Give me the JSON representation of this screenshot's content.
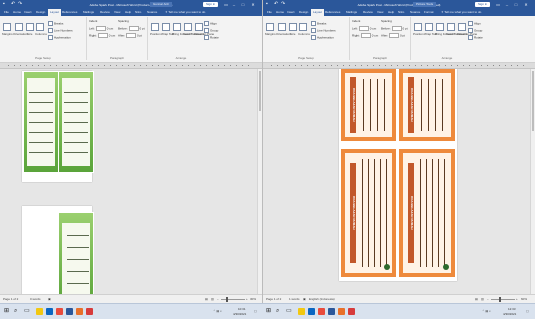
{
  "left_window": {
    "title": "Adobe Spark Post - Microsoft Word (Product Activation Failed)",
    "title_extra": "Gunnar Anh",
    "sign_in": "Sign in",
    "quick_access": [
      "save-icon",
      "undo-icon",
      "redo-icon"
    ],
    "tabs": [
      "File",
      "Home",
      "Insert",
      "Design",
      "Layout",
      "References",
      "Mailings",
      "Review",
      "View",
      "Help",
      "Nitro",
      "Nuance"
    ],
    "active_tab": "Layout",
    "tell_me": "Tell me what you want to do",
    "ribbon": {
      "big_buttons": [
        "Margins",
        "Orientation",
        "Size",
        "Columns"
      ],
      "page_setup_options": [
        "Breaks",
        "Line Numbers",
        "Hyphenation"
      ],
      "indent": {
        "title": "Indent",
        "left_label": "Left:",
        "left_value": "0 cm",
        "right_label": "Right:",
        "right_value": "0 cm"
      },
      "spacing": {
        "title": "Spacing",
        "before_label": "Before:",
        "before_value": "0 pt",
        "after_label": "After:",
        "after_value": "0 pt"
      },
      "arrange_buttons": [
        "Position",
        "Wrap Text",
        "Bring Forward",
        "Send Backward",
        "Selection Pane"
      ],
      "arrange_options": [
        "Align",
        "Group",
        "Rotate"
      ],
      "group_labels": [
        "Page Setup",
        "Paragraph",
        "Arrange"
      ]
    },
    "status": {
      "page": "Page 1 of 2",
      "words": "0 words",
      "zoom": "30%"
    }
  },
  "right_window": {
    "title": "Adobe Spark Post - Microsoft Word (Product Activation Failed)",
    "title_extra": "Picture Tools",
    "sign_in": "Sign in",
    "quick_access": [
      "save-icon",
      "undo-icon",
      "redo-icon"
    ],
    "tabs": [
      "File",
      "Home",
      "Insert",
      "Design",
      "Layout",
      "References",
      "Mailings",
      "Review",
      "View",
      "Help",
      "Nitro",
      "Nuance",
      "Format"
    ],
    "active_tab": "Layout",
    "tell_me": "Tell me what you want to do",
    "ribbon": {
      "big_buttons": [
        "Margins",
        "Orientation",
        "Size",
        "Columns"
      ],
      "page_setup_options": [
        "Breaks",
        "Line Numbers",
        "Hyphenation"
      ],
      "indent": {
        "title": "Indent",
        "left_label": "Left:",
        "left_value": "0 cm",
        "right_label": "Right:",
        "right_value": "0 cm"
      },
      "spacing": {
        "title": "Spacing",
        "before_label": "Before:",
        "before_value": "0 pt",
        "after_label": "After:",
        "after_value": "0 pt"
      },
      "arrange_buttons": [
        "Position",
        "Wrap Text",
        "Bring Forward",
        "Send Backward",
        "Selection Pane"
      ],
      "arrange_options": [
        "Align",
        "Group",
        "Rotate"
      ],
      "group_labels": [
        "Page Setup",
        "Paragraph",
        "Arrange"
      ]
    },
    "card_banner": "DOA BELAJAR RUMAH",
    "status": {
      "page": "Page 1 of 2",
      "words": "1 words",
      "language": "English (Indonesia)",
      "zoom": "60%"
    }
  },
  "taskbar": {
    "left_clock": {
      "time": "10:31",
      "date": "4/30/2021"
    },
    "right_clock": {
      "time": "12:33",
      "date": "4/30/2021"
    }
  },
  "colors": {
    "word_blue": "#2b579a",
    "card_green": "#5aa43a",
    "card_orange": "#ee8a3c"
  }
}
